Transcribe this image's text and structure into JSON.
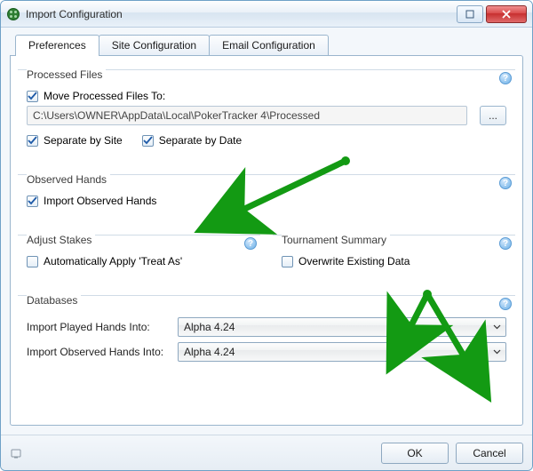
{
  "window": {
    "title": "Import Configuration"
  },
  "tabs": {
    "preferences": "Preferences",
    "site_config": "Site Configuration",
    "email_config": "Email Configuration",
    "active": "preferences"
  },
  "processed_files": {
    "group_label": "Processed Files",
    "move_to": {
      "label": "Move Processed Files To:",
      "checked": true
    },
    "path": "C:\\Users\\OWNER\\AppData\\Local\\PokerTracker 4\\Processed",
    "browse_label": "...",
    "separate_site": {
      "label": "Separate by Site",
      "checked": true
    },
    "separate_date": {
      "label": "Separate by Date",
      "checked": true
    }
  },
  "observed_hands": {
    "group_label": "Observed Hands",
    "import_observed": {
      "label": "Import Observed Hands",
      "checked": true
    }
  },
  "adjust_stakes": {
    "group_label": "Adjust Stakes",
    "auto_treat_as": {
      "label": "Automatically Apply 'Treat As'",
      "checked": false
    }
  },
  "tournament_summary": {
    "group_label": "Tournament Summary",
    "overwrite": {
      "label": "Overwrite Existing Data",
      "checked": false
    }
  },
  "databases": {
    "group_label": "Databases",
    "played_label": "Import Played Hands Into:",
    "observed_label": "Import Observed Hands Into:",
    "played_value": "Alpha 4.24",
    "observed_value": "Alpha 4.24"
  },
  "footer": {
    "ok": "OK",
    "cancel": "Cancel"
  },
  "help_glyph": "?"
}
